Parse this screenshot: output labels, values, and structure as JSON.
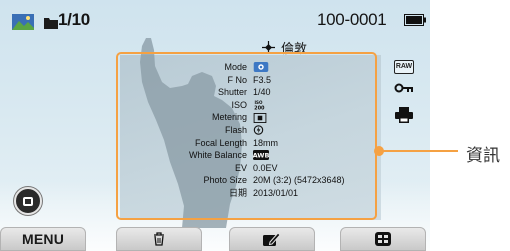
{
  "status_bar": {
    "file_counter": "1/10",
    "file_number": "100-0001",
    "location_label": "倫敦"
  },
  "icons": {
    "raw_badge": "RAW",
    "thumbnail": "image-thumbnail-icon",
    "folder": "folder-icon",
    "battery": "battery-full-icon",
    "location": "gps-location-icon",
    "protect": "key-icon",
    "print": "printer-icon"
  },
  "info": {
    "labels": [
      "Mode",
      "F No",
      "Shutter",
      "ISO",
      "Metering",
      "Flash",
      "Focal Length",
      "White Balance",
      "EV",
      "Photo Size"
    ],
    "values": {
      "f_no": "F3.5",
      "shutter": "1/40",
      "iso": "ISO 200",
      "white_balance": "AWB",
      "focal_length": "18mm",
      "ev": "0.0EV",
      "photo_size": "20M (3:2) (5472x3648)"
    },
    "date_label": "日期",
    "date_value": "2013/01/01"
  },
  "softkeys": {
    "menu": "MENU"
  },
  "callout": {
    "label": "資訊",
    "color": "#f5a143"
  }
}
